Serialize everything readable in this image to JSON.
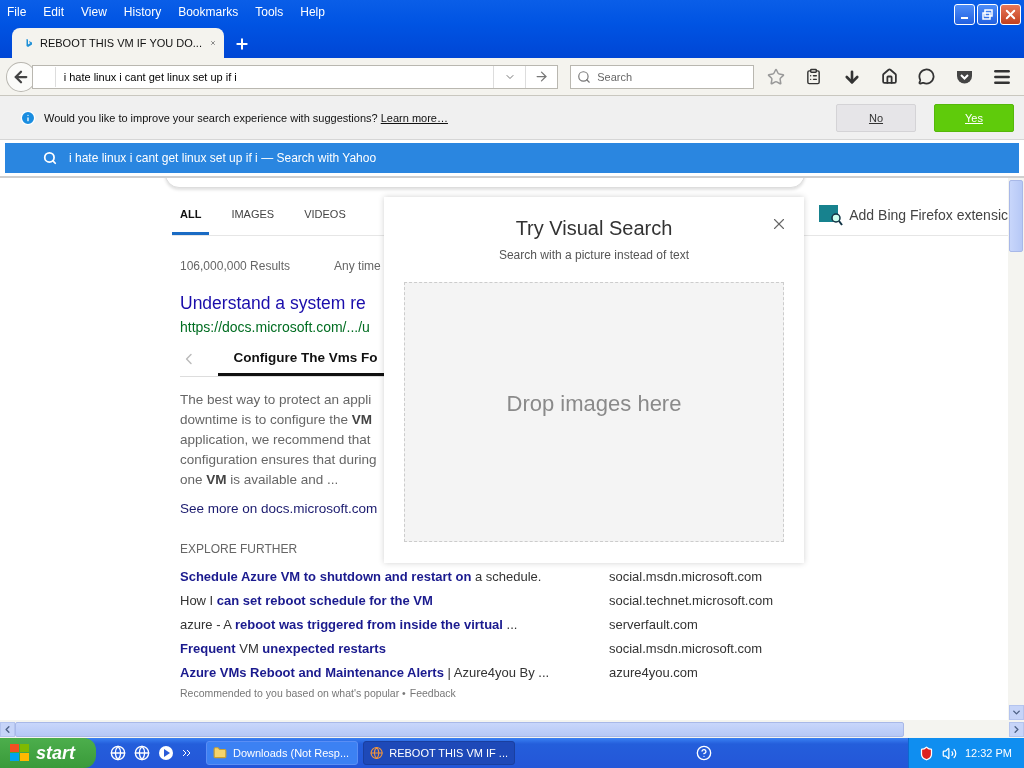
{
  "menu": [
    "File",
    "Edit",
    "View",
    "History",
    "Bookmarks",
    "Tools",
    "Help"
  ],
  "browser_tab": {
    "title": "REBOOT THIS VM IF YOU DO...",
    "selected": true
  },
  "address_bar": {
    "value": "i hate linux i cant get linux set up if i"
  },
  "search_field": {
    "placeholder": "Search"
  },
  "notification": {
    "text": "Would you like to improve your search experience with suggestions?",
    "link": "Learn more…",
    "buttons": [
      {
        "label": "No",
        "kind": "secondary"
      },
      {
        "label": "Yes",
        "kind": "primary"
      }
    ]
  },
  "suggestion": {
    "query": "i hate linux i cant get linux set up if i",
    "suffix": "— Search with Yahoo",
    "selected": true
  },
  "page": {
    "tabs": [
      {
        "label": "ALL",
        "selected": true
      },
      {
        "label": "IMAGES",
        "selected": false
      },
      {
        "label": "VIDEOS",
        "selected": false
      }
    ],
    "extension": "Add Bing Firefox extensic",
    "result_count": "106,000,000 Results",
    "time_filter": "Any time",
    "result": {
      "title": "Understand a system re",
      "url": "https://docs.microsoft.com/.../u",
      "carousel_tab": "Configure The Vms Fo",
      "snippet": [
        "The best way to protect an appli",
        "downtime is to configure the **VM**",
        "application, we recommend that",
        "configuration ensures that during",
        "one **VM** is available and ..."
      ],
      "see_more": "See more on docs.microsoft.com"
    },
    "explore_heading": "EXPLORE FURTHER",
    "explore": [
      {
        "title": "**Schedule Azure VM to shutdown and restart on** a schedule.",
        "site": "social.msdn.microsoft.com"
      },
      {
        "title": "How I **can set reboot schedule for the VM**",
        "site": "social.technet.microsoft.com"
      },
      {
        "title": "azure - A **reboot was triggered from inside the virtual** ...",
        "site": "serverfault.com"
      },
      {
        "title": "**Frequent** VM **unexpected restarts**",
        "site": "social.msdn.microsoft.com"
      },
      {
        "title": "**Azure VMs Reboot and Maintenance Alerts** | Azure4you By ...",
        "site": "azure4you.com"
      }
    ],
    "footer": "Recommended to you based on what's popular •",
    "feedback": "Feedback"
  },
  "visual_search": {
    "title": "Try Visual Search",
    "subtitle": "Search with a picture instead of text",
    "drop_text": "Drop images here"
  },
  "taskbar": {
    "start": "start",
    "tasks": [
      {
        "label": "Downloads (Not Resp...",
        "kind": "folder",
        "selected": false
      },
      {
        "label": "REBOOT THIS VM IF ...",
        "kind": "browser",
        "selected": true
      }
    ],
    "clock": "12:32 PM"
  }
}
